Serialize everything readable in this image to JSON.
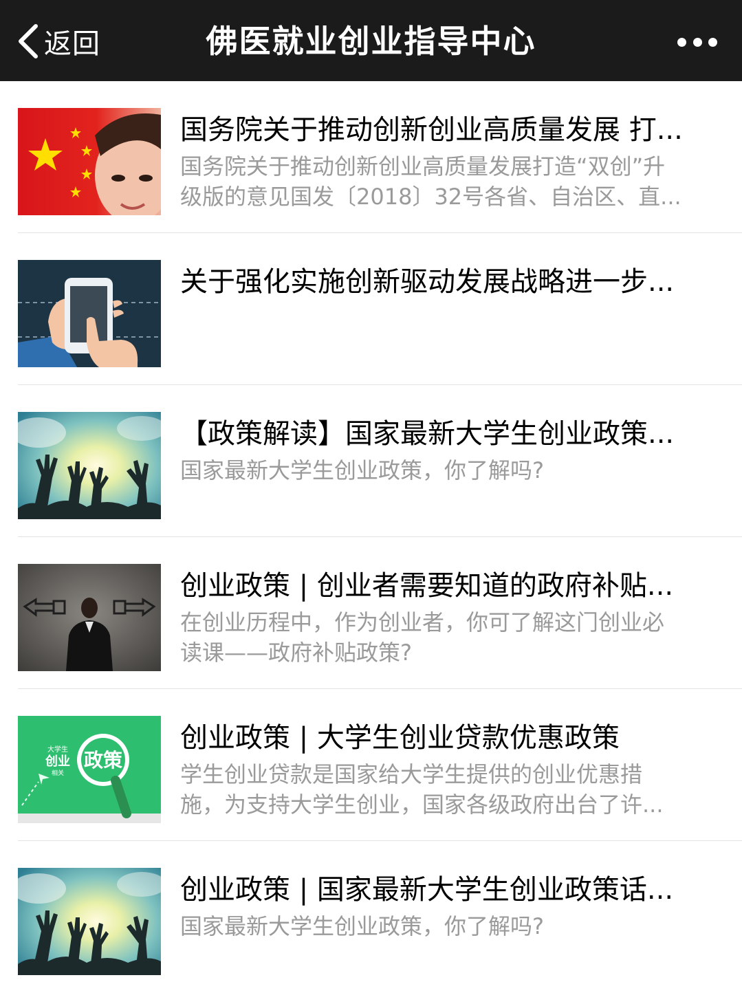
{
  "navbar": {
    "back_label": "返回",
    "title": "佛医就业创业指导中心",
    "background": "#1b1b1b"
  },
  "articles": [
    {
      "thumb": "flag-child",
      "title": "国务院关于推动创新创业高质量发展 打...",
      "desc": "国务院关于推动创新创业高质量发展打造“双创”升\n级版的意见国发〔2018〕32号各省、自治区、直..."
    },
    {
      "thumb": "phone-hand",
      "title": "关于强化实施创新驱动发展战略进一步...",
      "desc": ""
    },
    {
      "thumb": "hands-sky",
      "title": "【政策解读】国家最新大学生创业政策...",
      "desc": "国家最新大学生创业政策，你了解吗?"
    },
    {
      "thumb": "man-arrows",
      "title": "创业政策 | 创业者需要知道的政府补贴...",
      "desc": "在创业历程中，作为创业者，你可了解这门创业必\n读课——政府补贴政策?"
    },
    {
      "thumb": "policy-green",
      "thumb_text": {
        "top": "大学生",
        "mid": "创业",
        "bot": "相关",
        "badge": "政策"
      },
      "title": "创业政策 | 大学生创业贷款优惠政策",
      "desc": "学生创业贷款是国家给大学生提供的创业优惠措\n施，为支持大学生创业，国家各级政府出台了许..."
    },
    {
      "thumb": "hands-sky",
      "title": "创业政策 | 国家最新大学生创业政策话...",
      "desc": "国家最新大学生创业政策，你了解吗?"
    }
  ]
}
